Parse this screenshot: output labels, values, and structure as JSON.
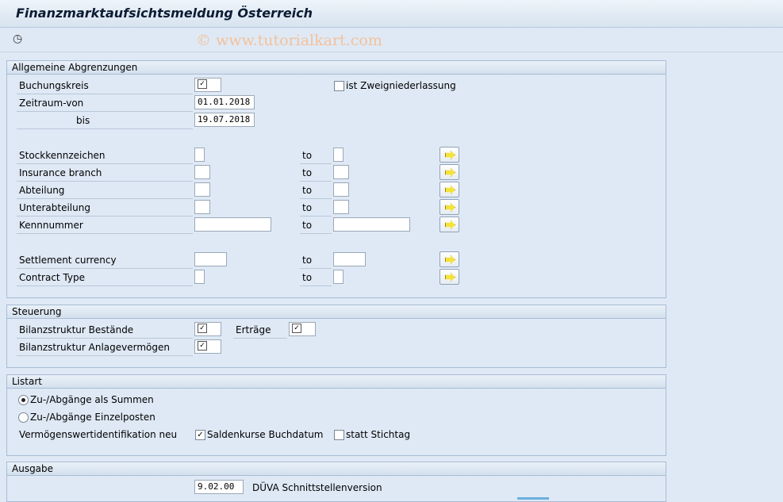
{
  "window": {
    "title": "Finanzmarktaufsichtsmeldung Österreich"
  },
  "toolbar": {
    "execute_icon": "clock-execute-icon",
    "watermark": "© www.tutorialkart.com"
  },
  "general": {
    "header": "Allgemeine Abgrenzungen",
    "company_code_label": "Buchungskreis",
    "branch_label": "ist Zweigniederlassung",
    "period_from_label": "Zeitraum-von",
    "period_from_value": "01.01.2018",
    "period_to_label": "bis",
    "period_to_value": "19.07.2018",
    "to_label": "to",
    "ranges": [
      {
        "label": "Stockkennzeichen"
      },
      {
        "label": "Insurance branch"
      },
      {
        "label": "Abteilung"
      },
      {
        "label": "Unterabteilung"
      },
      {
        "label": "Kennnummer"
      },
      {
        "label": "Settlement currency"
      },
      {
        "label": "Contract Type"
      }
    ]
  },
  "control": {
    "header": "Steuerung",
    "balance_stock_label": "Bilanzstruktur Bestände",
    "income_label": "Erträge",
    "balance_assets_label": "Bilanzstruktur Anlagevermögen"
  },
  "listtype": {
    "header": "Listart",
    "option_sums": "Zu-/Abgänge als Summen",
    "option_items": "Zu-/Abgänge Einzelposten",
    "asset_id_label": "Vermögenswertidentifikation neu",
    "posting_date_label": "Saldenkurse Buchdatum",
    "key_date_label": "statt Stichtag"
  },
  "output": {
    "header": "Ausgabe",
    "version_value": "9.02.00",
    "version_label": "DÜVA Schnittstellenversion"
  }
}
